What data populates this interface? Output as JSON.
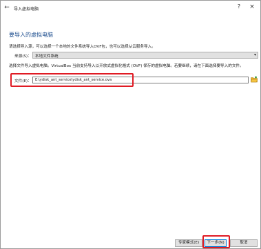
{
  "window": {
    "title": "导入虚拟电脑",
    "back_icon": "arrow-left-icon",
    "help_label": "?",
    "close_label": "×"
  },
  "page": {
    "heading": "要导入的虚拟电脑",
    "description_source": "请选择导入源，可以选择一个本地的文件系统导入OVF包，也可以选择从云服务导入。",
    "source_label": "来源(S)：",
    "source_value": "本地文件系统",
    "description_file": "选择文件导入虚拟电脑。VirtualBox 当前支持导入以开放式虚拟化格式 (OVF) 保存的虚拟电脑。若要继续，请在下面选择要导入的文件。",
    "file_label": "文件(E)：",
    "file_value": "E:\\ydisk_ant_service\\ydisk_ant_service.ova"
  },
  "buttons": {
    "expert": "专家模式(E)",
    "next": "下一步(N)",
    "cancel": "取消"
  },
  "colors": {
    "heading": "#1f4f8f",
    "highlight": "#e01b24",
    "folder_icon": "#e8b02b"
  }
}
